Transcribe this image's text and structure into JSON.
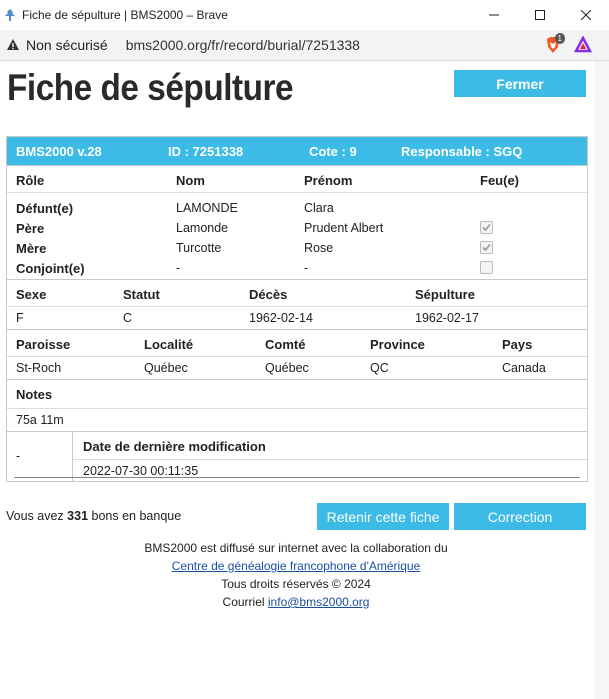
{
  "window": {
    "title": "Fiche de sépulture | BMS2000 – Brave",
    "not_secure": "Non sécurisé",
    "url": "bms2000.org/fr/record/burial/7251338",
    "brave_badge": "1"
  },
  "page": {
    "title": "Fiche de sépulture",
    "close_button": "Fermer"
  },
  "record": {
    "header": {
      "version": "BMS2000 v.28",
      "id": "ID : 7251338",
      "cote": "Cote : 9",
      "responsable": "Responsable : SGQ"
    },
    "persons": {
      "columns": [
        "Rôle",
        "Nom",
        "Prénom",
        "Feu(e)"
      ],
      "rows": [
        {
          "role": "Défunt(e)",
          "nom": "LAMONDE",
          "prenom": "Clara",
          "feu": null
        },
        {
          "role": "Père",
          "nom": "Lamonde",
          "prenom": "Prudent Albert",
          "feu": true
        },
        {
          "role": "Mère",
          "nom": "Turcotte",
          "prenom": "Rose",
          "feu": true
        },
        {
          "role": "Conjoint(e)",
          "nom": "-",
          "prenom": "-",
          "feu": false
        }
      ]
    },
    "event": {
      "columns": [
        "Sexe",
        "Statut",
        "Décès",
        "Sépulture"
      ],
      "values": [
        "F",
        "C",
        "1962-02-14",
        "1962-02-17"
      ]
    },
    "place": {
      "columns": [
        "Paroisse",
        "Localité",
        "Comté",
        "Province",
        "Pays"
      ],
      "values": [
        "St-Roch",
        "Québec",
        "Québec",
        "QC",
        "Canada"
      ]
    },
    "notes": {
      "label": "Notes",
      "value": "75a 11m"
    },
    "modification": {
      "left": "-",
      "label": "Date de dernière modification",
      "value": "2022-07-30 00:11:35"
    }
  },
  "bank": {
    "prefix": "Vous avez",
    "count": "331",
    "suffix": "bons en banque"
  },
  "actions": {
    "retain": "Retenir cette fiche",
    "correction": "Correction"
  },
  "footer": {
    "line1": "BMS2000 est diffusé sur internet avec la collaboration du",
    "link": "Centre de généalogie francophone d'Amérique",
    "rights": "Tous droits réservés © 2024",
    "mail_label": "Courriel",
    "email": "info@bms2000.org"
  },
  "colors": {
    "accent": "#3bbbe6"
  }
}
